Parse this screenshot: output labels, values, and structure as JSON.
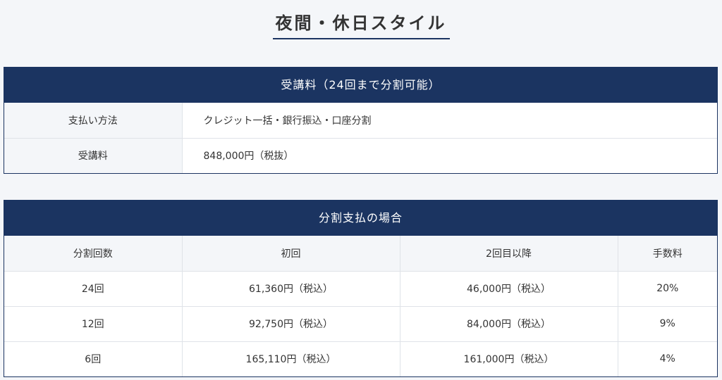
{
  "page_title": "夜間・休日スタイル",
  "fee_table": {
    "header": "受講料（24回まで分割可能）",
    "rows": [
      {
        "label": "支払い方法",
        "value": "クレジット一括・銀行振込・口座分割"
      },
      {
        "label": "受講料",
        "value": "848,000円（税抜）"
      }
    ]
  },
  "installment_table": {
    "header": "分割支払の場合",
    "columns": [
      "分割回数",
      "初回",
      "2回目以降",
      "手数料"
    ],
    "rows": [
      [
        "24回",
        "61,360円（税込）",
        "46,000円（税込）",
        "20%"
      ],
      [
        "12回",
        "92,750円（税込）",
        "84,000円（税込）",
        "9%"
      ],
      [
        "6回",
        "165,110円（税込）",
        "161,000円（税込）",
        "4%"
      ]
    ]
  },
  "colors": {
    "navy": "#1b3461",
    "label_bg": "#f4f6f9",
    "border": "#dfe3e8"
  }
}
